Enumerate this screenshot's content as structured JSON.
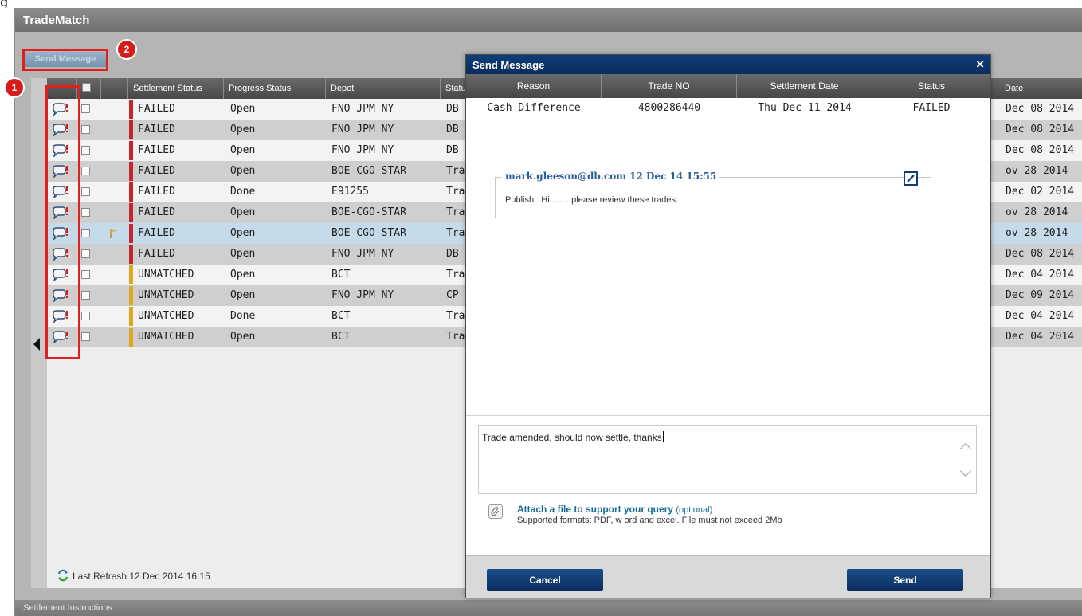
{
  "app": {
    "title": "TradeMatch",
    "send_message_button": "Send Message",
    "badge_1": "1",
    "badge_2": "2",
    "last_refresh": "Last Refresh 12 Dec 2014 16:15",
    "bottom_panel": "Settlement Instructions"
  },
  "grid": {
    "columns": [
      "Settlement Status",
      "Progress Status",
      "Depot",
      "Status",
      "Date"
    ],
    "rows": [
      {
        "settlement": "FAILED",
        "progress": "Open",
        "depot": "FNO JPM NY",
        "status": "DB I",
        "date": "Dec 08 2014"
      },
      {
        "settlement": "FAILED",
        "progress": "Open",
        "depot": "FNO JPM NY",
        "status": "DB I",
        "date": "Dec 08 2014"
      },
      {
        "settlement": "FAILED",
        "progress": "Open",
        "depot": "FNO JPM NY",
        "status": "DB I",
        "date": "Dec 08 2014"
      },
      {
        "settlement": "FAILED",
        "progress": "Open",
        "depot": "BOE-CGO-STAR",
        "status": "Trad",
        "date": "ov 28 2014"
      },
      {
        "settlement": "FAILED",
        "progress": "Done",
        "depot": "E91255",
        "status": "Trad",
        "date": "Dec 02 2014"
      },
      {
        "settlement": "FAILED",
        "progress": "Open",
        "depot": "BOE-CGO-STAR",
        "status": "Trad",
        "date": "ov 28 2014"
      },
      {
        "settlement": "FAILED",
        "progress": "Open",
        "depot": "BOE-CGO-STAR",
        "status": "Trad",
        "date": "ov 28 2014"
      },
      {
        "settlement": "FAILED",
        "progress": "Open",
        "depot": "FNO JPM NY",
        "status": "DB I",
        "date": "Dec 08 2014"
      },
      {
        "settlement": "UNMATCHED",
        "progress": "Open",
        "depot": "BCT",
        "status": "Trad",
        "date": "Dec 04 2014"
      },
      {
        "settlement": "UNMATCHED",
        "progress": "Open",
        "depot": "FNO JPM NY",
        "status": "CP N",
        "date": "Dec 09 2014"
      },
      {
        "settlement": "UNMATCHED",
        "progress": "Done",
        "depot": "BCT",
        "status": "Trad",
        "date": "Dec 04 2014"
      },
      {
        "settlement": "UNMATCHED",
        "progress": "Open",
        "depot": "BCT",
        "status": "Trad",
        "date": "Dec 04 2014"
      }
    ],
    "colors": {
      "failed": "#c8242c",
      "unmatched": "#e0a81c"
    }
  },
  "modal": {
    "title": "Send Message",
    "close": "×",
    "columns": [
      "Reason",
      "Trade NO",
      "Settlement Date",
      "Status"
    ],
    "row": {
      "reason": "Cash Difference",
      "trade_no": "4800286440",
      "settlement_date": "Thu Dec 11 2014",
      "status": "FAILED"
    },
    "comment_author": "mark.gleeson@db.com 12 Dec 14 15:55",
    "comment_body": "Publish : Hi........    please review  these trades.",
    "reply_text": "Trade amended, should now settle, thanks",
    "attach_link": "Attach a file to support your query",
    "attach_optional": "(optional)",
    "attach_note": "Supported formats: PDF, w ord and excel. File must not exceed 2Mb",
    "cancel": "Cancel",
    "send": "Send"
  }
}
